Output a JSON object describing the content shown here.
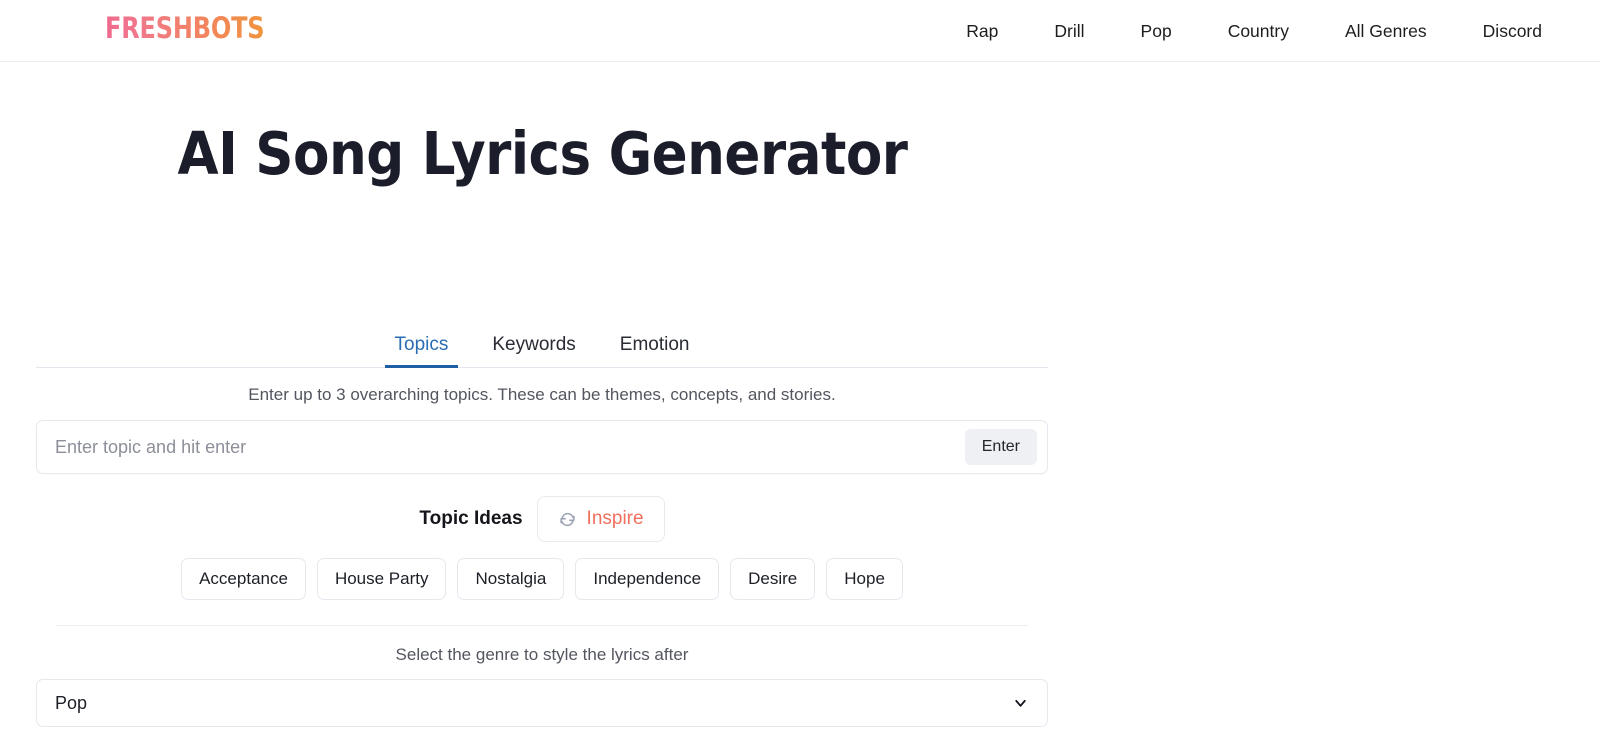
{
  "brand": {
    "name": "FRESHBOTS",
    "gradient_from": "#ef6a8d",
    "gradient_to": "#f0943c"
  },
  "nav": {
    "items": [
      {
        "label": "Rap"
      },
      {
        "label": "Drill"
      },
      {
        "label": "Pop"
      },
      {
        "label": "Country"
      },
      {
        "label": "All Genres"
      },
      {
        "label": "Discord"
      }
    ]
  },
  "page": {
    "title": "AI Song Lyrics Generator"
  },
  "tabs": {
    "active": "Topics",
    "items": [
      {
        "label": "Topics"
      },
      {
        "label": "Keywords"
      },
      {
        "label": "Emotion"
      }
    ],
    "active_color": "#2a6eb3",
    "underline_color": "#1e5fa3"
  },
  "topics": {
    "hint": "Enter up to 3 overarching topics. These can be themes, concepts, and stories.",
    "input_value": "",
    "input_placeholder": "Enter topic and hit enter",
    "enter_label": "Enter",
    "ideas_label": "Topic Ideas",
    "inspire_label": "Inspire",
    "inspire_color": "#f0705d",
    "inspire_icon": "refresh-icon",
    "chips": [
      {
        "label": "Acceptance"
      },
      {
        "label": "House Party"
      },
      {
        "label": "Nostalgia"
      },
      {
        "label": "Independence"
      },
      {
        "label": "Desire"
      },
      {
        "label": "Hope"
      }
    ]
  },
  "genre": {
    "hint": "Select the genre to style the lyrics after",
    "selected": "Pop",
    "chevron_icon": "chevron-down-icon"
  }
}
